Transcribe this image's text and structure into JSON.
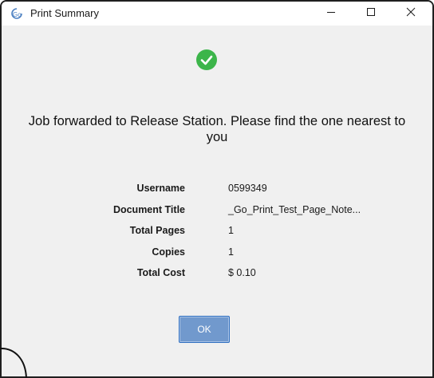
{
  "window": {
    "title": "Print Summary",
    "app_icon": "go-print-icon",
    "controls": [
      "minimize-icon",
      "maximize-icon",
      "close-icon"
    ]
  },
  "status": {
    "icon": "success-check-icon",
    "icon_color": "#3cb54a",
    "message": "Job forwarded to Release Station. Please find the one nearest to you"
  },
  "details": [
    {
      "label": "Username",
      "value": "0599349"
    },
    {
      "label": "Document Title",
      "value": "_Go_Print_Test_Page_Note..."
    },
    {
      "label": "Total Pages",
      "value": "1"
    },
    {
      "label": "Copies",
      "value": "1"
    },
    {
      "label": "Total Cost",
      "value": "$ 0.10"
    }
  ],
  "ok_button": {
    "label": "OK",
    "color": "#7199cd"
  }
}
